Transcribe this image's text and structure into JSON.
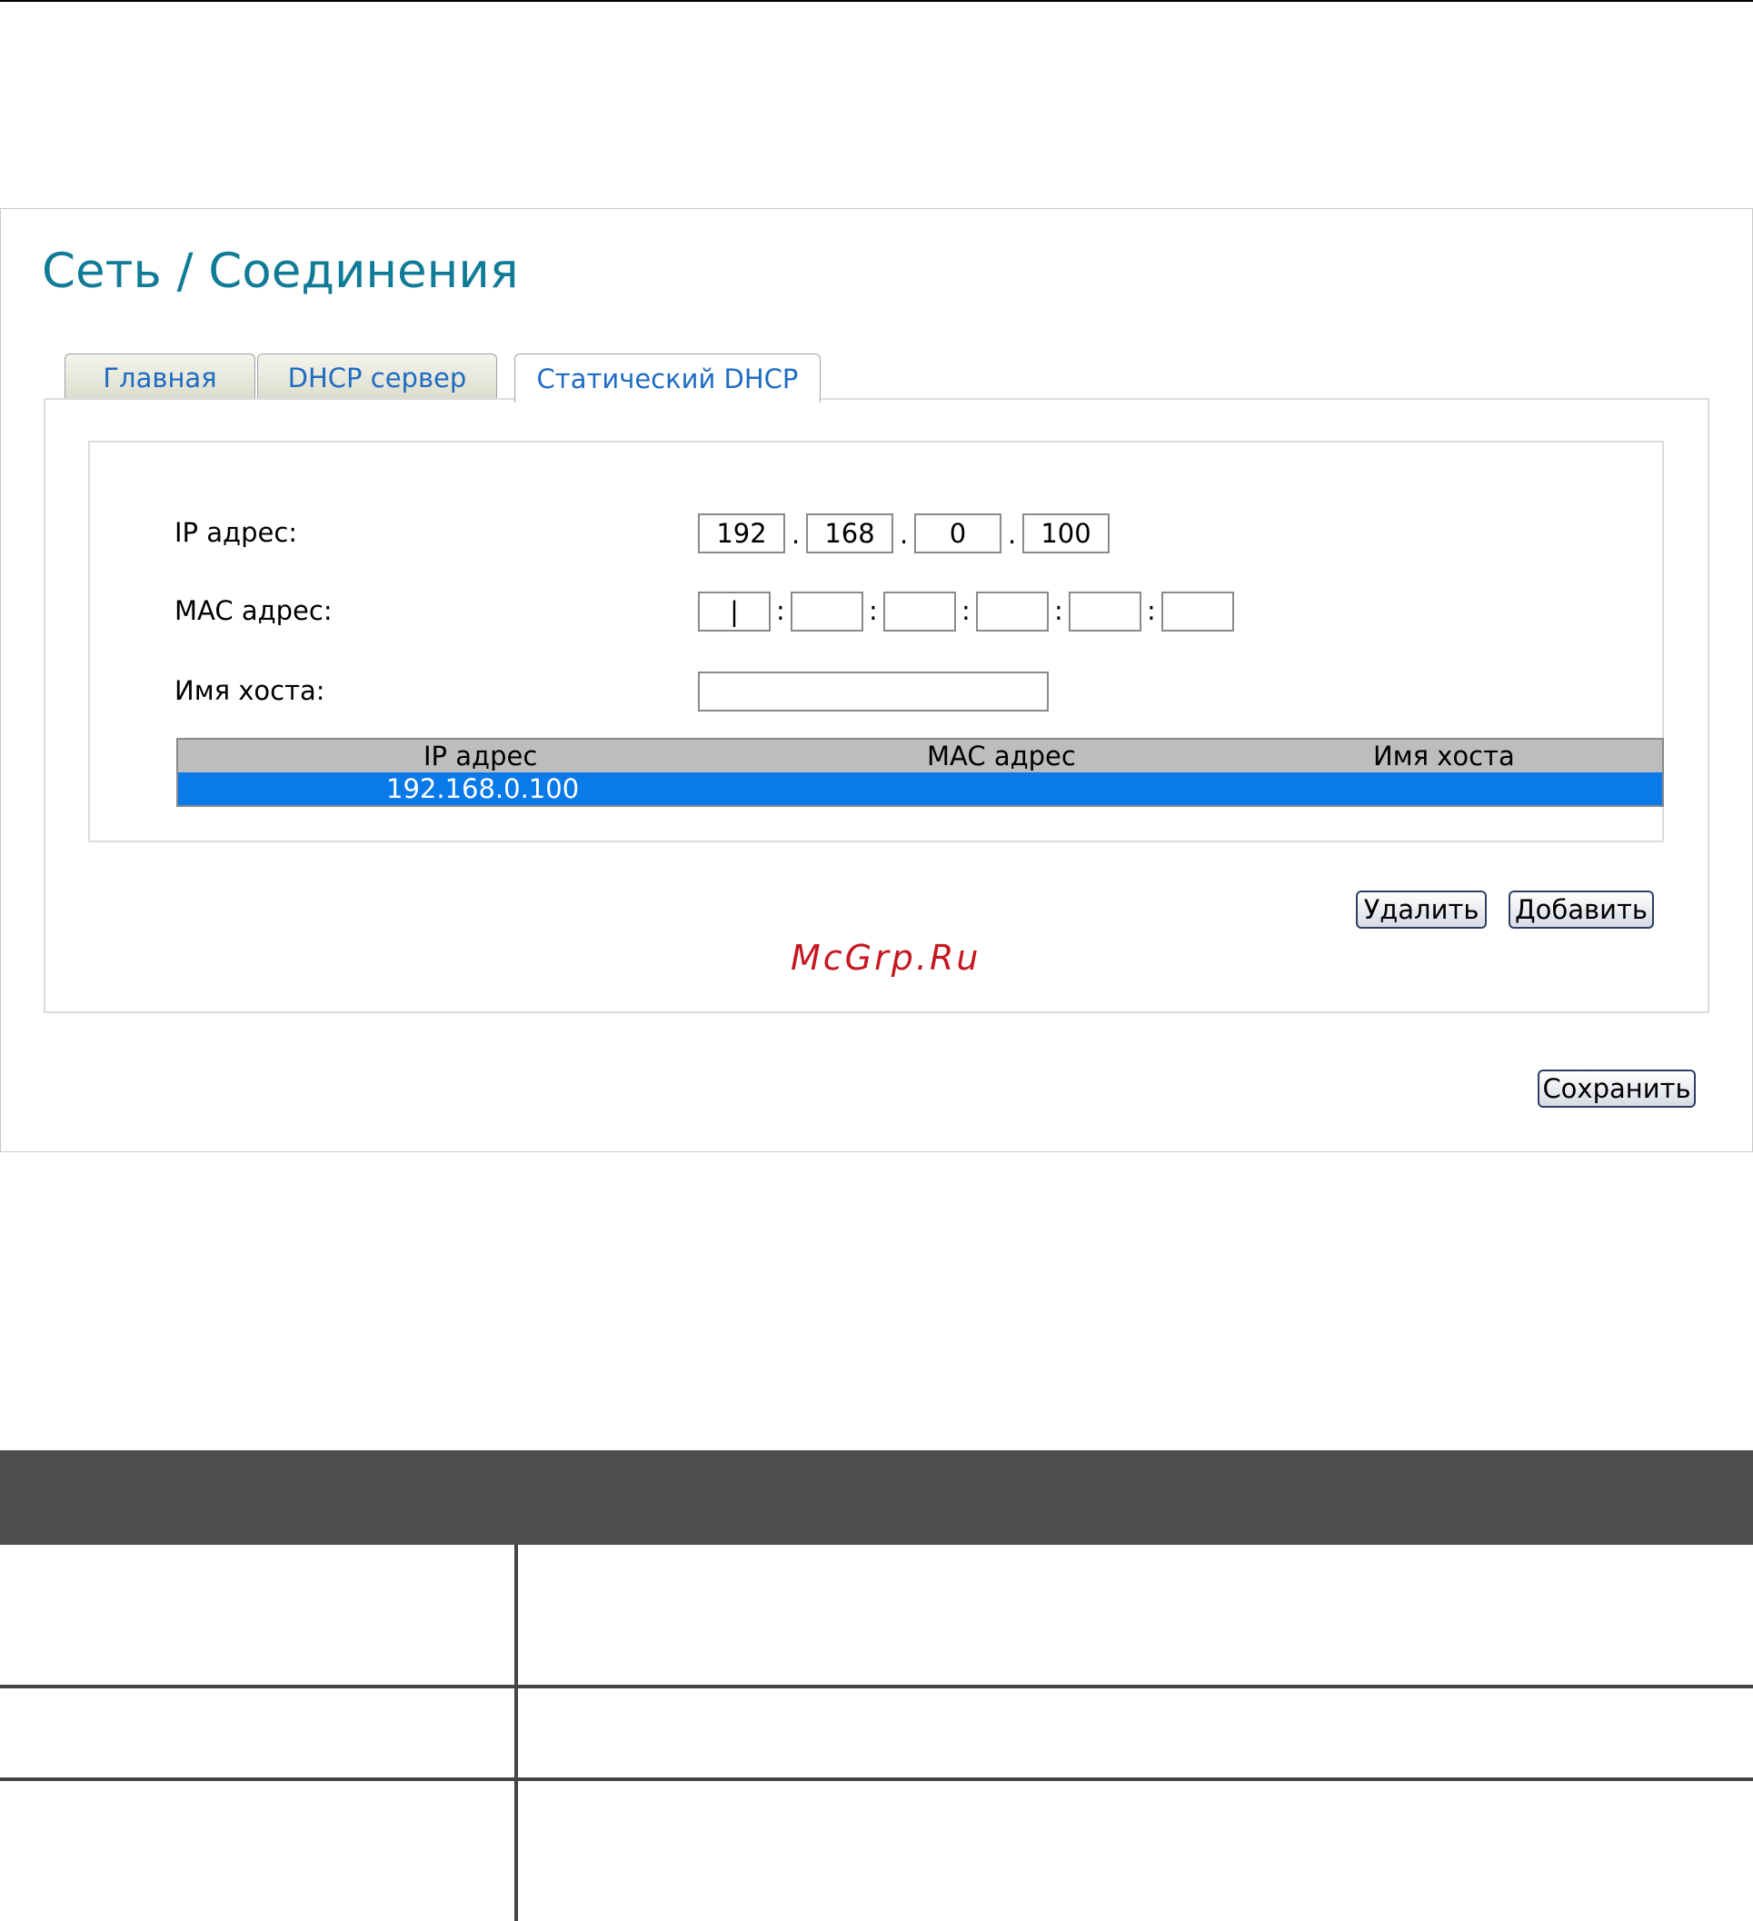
{
  "page": {
    "title": "Сеть / Соединения",
    "tabs": [
      {
        "label": "Главная"
      },
      {
        "label": "DHCP сервер"
      },
      {
        "label": "Статический DHCP"
      }
    ]
  },
  "form": {
    "ip_label": "IP адрес:",
    "ip_octets": [
      "192",
      "168",
      "0",
      "100"
    ],
    "mac_label": "MAC адрес:",
    "mac_octets": [
      "|",
      "",
      "",
      "",
      "",
      ""
    ],
    "host_label": "Имя хоста:",
    "host_value": ""
  },
  "table": {
    "headers": [
      "IP адрес",
      "MAC адрес",
      "Имя хоста"
    ],
    "rows": [
      {
        "ip": "192.168.0.100",
        "mac": "",
        "host": ""
      }
    ]
  },
  "buttons": {
    "delete": "Удалить",
    "add": "Добавить",
    "save": "Сохранить"
  },
  "watermark": "McGrp.Ru",
  "colors": {
    "title": "#0f7b96",
    "tab_text": "#1d6cc2",
    "selected_row": "#0a7ae9",
    "watermark": "#c51820",
    "desc_header": "#4e4e4e"
  }
}
